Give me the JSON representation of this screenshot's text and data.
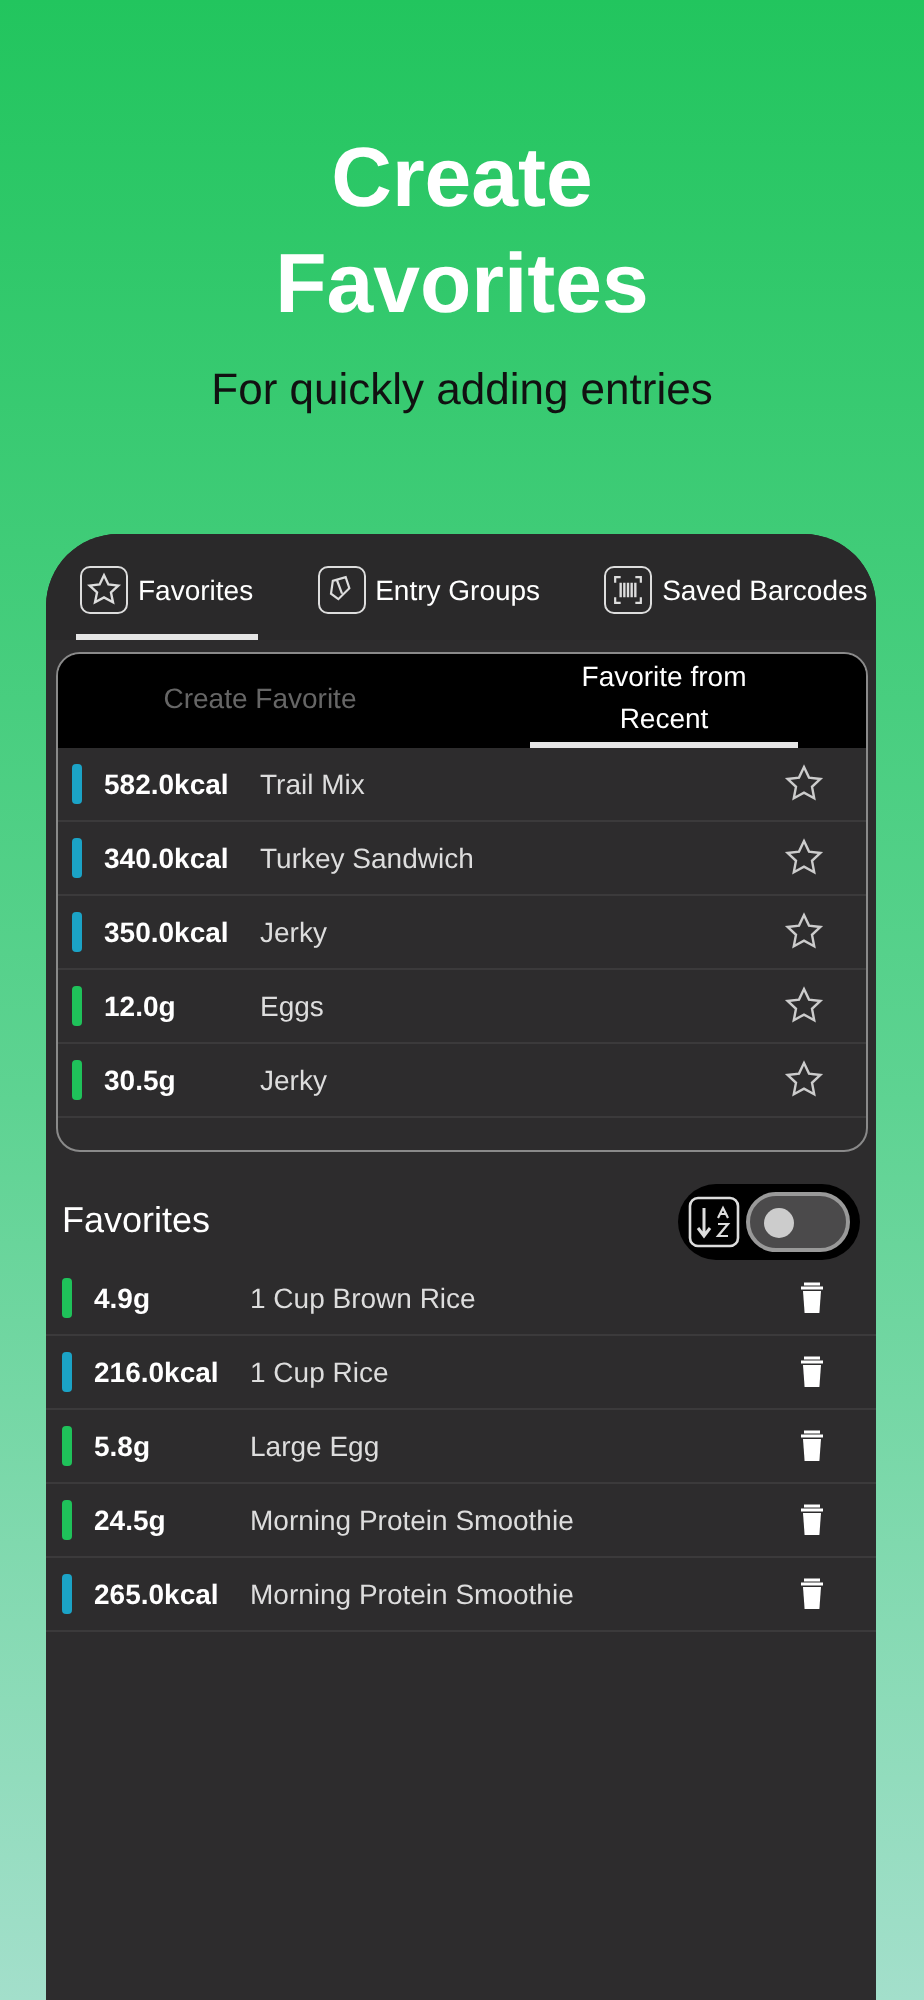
{
  "hero": {
    "title": "Create Favorites",
    "subtitle": "For quickly adding entries"
  },
  "top_tabs": [
    {
      "label": "Favorites",
      "kind": "star",
      "selected": true
    },
    {
      "label": "Entry Groups",
      "kind": "group",
      "selected": false
    },
    {
      "label": "Saved Barcodes",
      "kind": "barcode",
      "selected": false
    }
  ],
  "sub_tabs": [
    {
      "label": "Create Favorite",
      "selected": false
    },
    {
      "label": "Favorite from Recent",
      "selected": true
    }
  ],
  "recent": [
    {
      "amount": "582.0kcal",
      "name": "Trail Mix",
      "color": "#1ba3c6"
    },
    {
      "amount": "340.0kcal",
      "name": "Turkey Sandwich",
      "color": "#1ba3c6"
    },
    {
      "amount": "350.0kcal",
      "name": "Jerky",
      "color": "#1ba3c6"
    },
    {
      "amount": "12.0g",
      "name": "Eggs",
      "color": "#1fc25a"
    },
    {
      "amount": "30.5g",
      "name": "Jerky",
      "color": "#1fc25a"
    }
  ],
  "favorites": {
    "title": "Favorites",
    "sort_toggle": {
      "on": false
    },
    "items": [
      {
        "amount": "4.9g",
        "name": "1 Cup Brown Rice",
        "color": "#1fc25a"
      },
      {
        "amount": "216.0kcal",
        "name": "1 Cup Rice",
        "color": "#1ba3c6"
      },
      {
        "amount": "5.8g",
        "name": "Large Egg",
        "color": "#1fc25a"
      },
      {
        "amount": "24.5g",
        "name": "Morning Protein Smoothie",
        "color": "#1fc25a"
      },
      {
        "amount": "265.0kcal",
        "name": "Morning Protein Smoothie",
        "color": "#1ba3c6"
      }
    ]
  }
}
